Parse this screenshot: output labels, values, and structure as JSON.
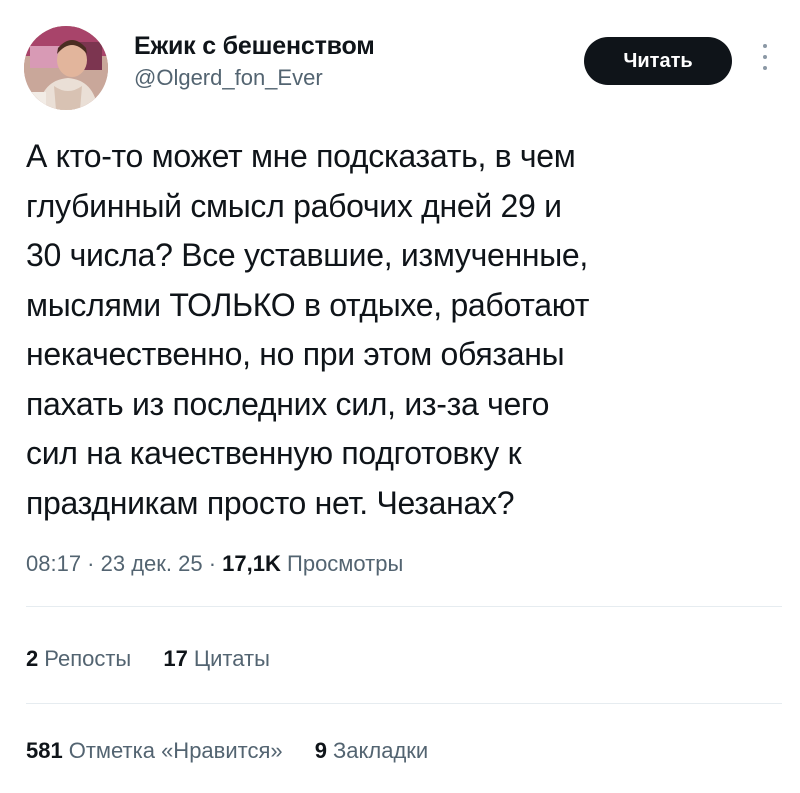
{
  "author": {
    "display_name": "Ежик с бешенством",
    "handle": "@Olgerd_fon_Ever"
  },
  "follow_button": {
    "label": "Читать"
  },
  "tweet": {
    "lines": [
      "А кто-то может мне подсказать, в чем",
      "глубинный смысл рабочих дней 29 и",
      "30 числа? Все уставшие, измученные,",
      "мыслями ТОЛЬКО в отдыхе, работают",
      "некачественно, но при этом обязаны",
      "пахать из последних сил, из-за чего",
      "сил на качественную подготовку к",
      "праздникам просто нет. Чезанах?"
    ]
  },
  "meta": {
    "time": "08:17",
    "separator": " · ",
    "date": "23 дек. 25",
    "views_count": "17,1K",
    "views_label": "Просмотры"
  },
  "stats": {
    "reposts_count": "2",
    "reposts_label": "Репосты",
    "quotes_count": "17",
    "quotes_label": "Цитаты",
    "likes_count": "581",
    "likes_label": "Отметка «Нравится»",
    "bookmarks_count": "9",
    "bookmarks_label": "Закладки"
  },
  "colors": {
    "text": "#0f1419",
    "secondary": "#536471",
    "button_bg": "#0f1419",
    "divider": "#e6ecf0"
  },
  "icons": {
    "more": "more-vertical-icon"
  }
}
